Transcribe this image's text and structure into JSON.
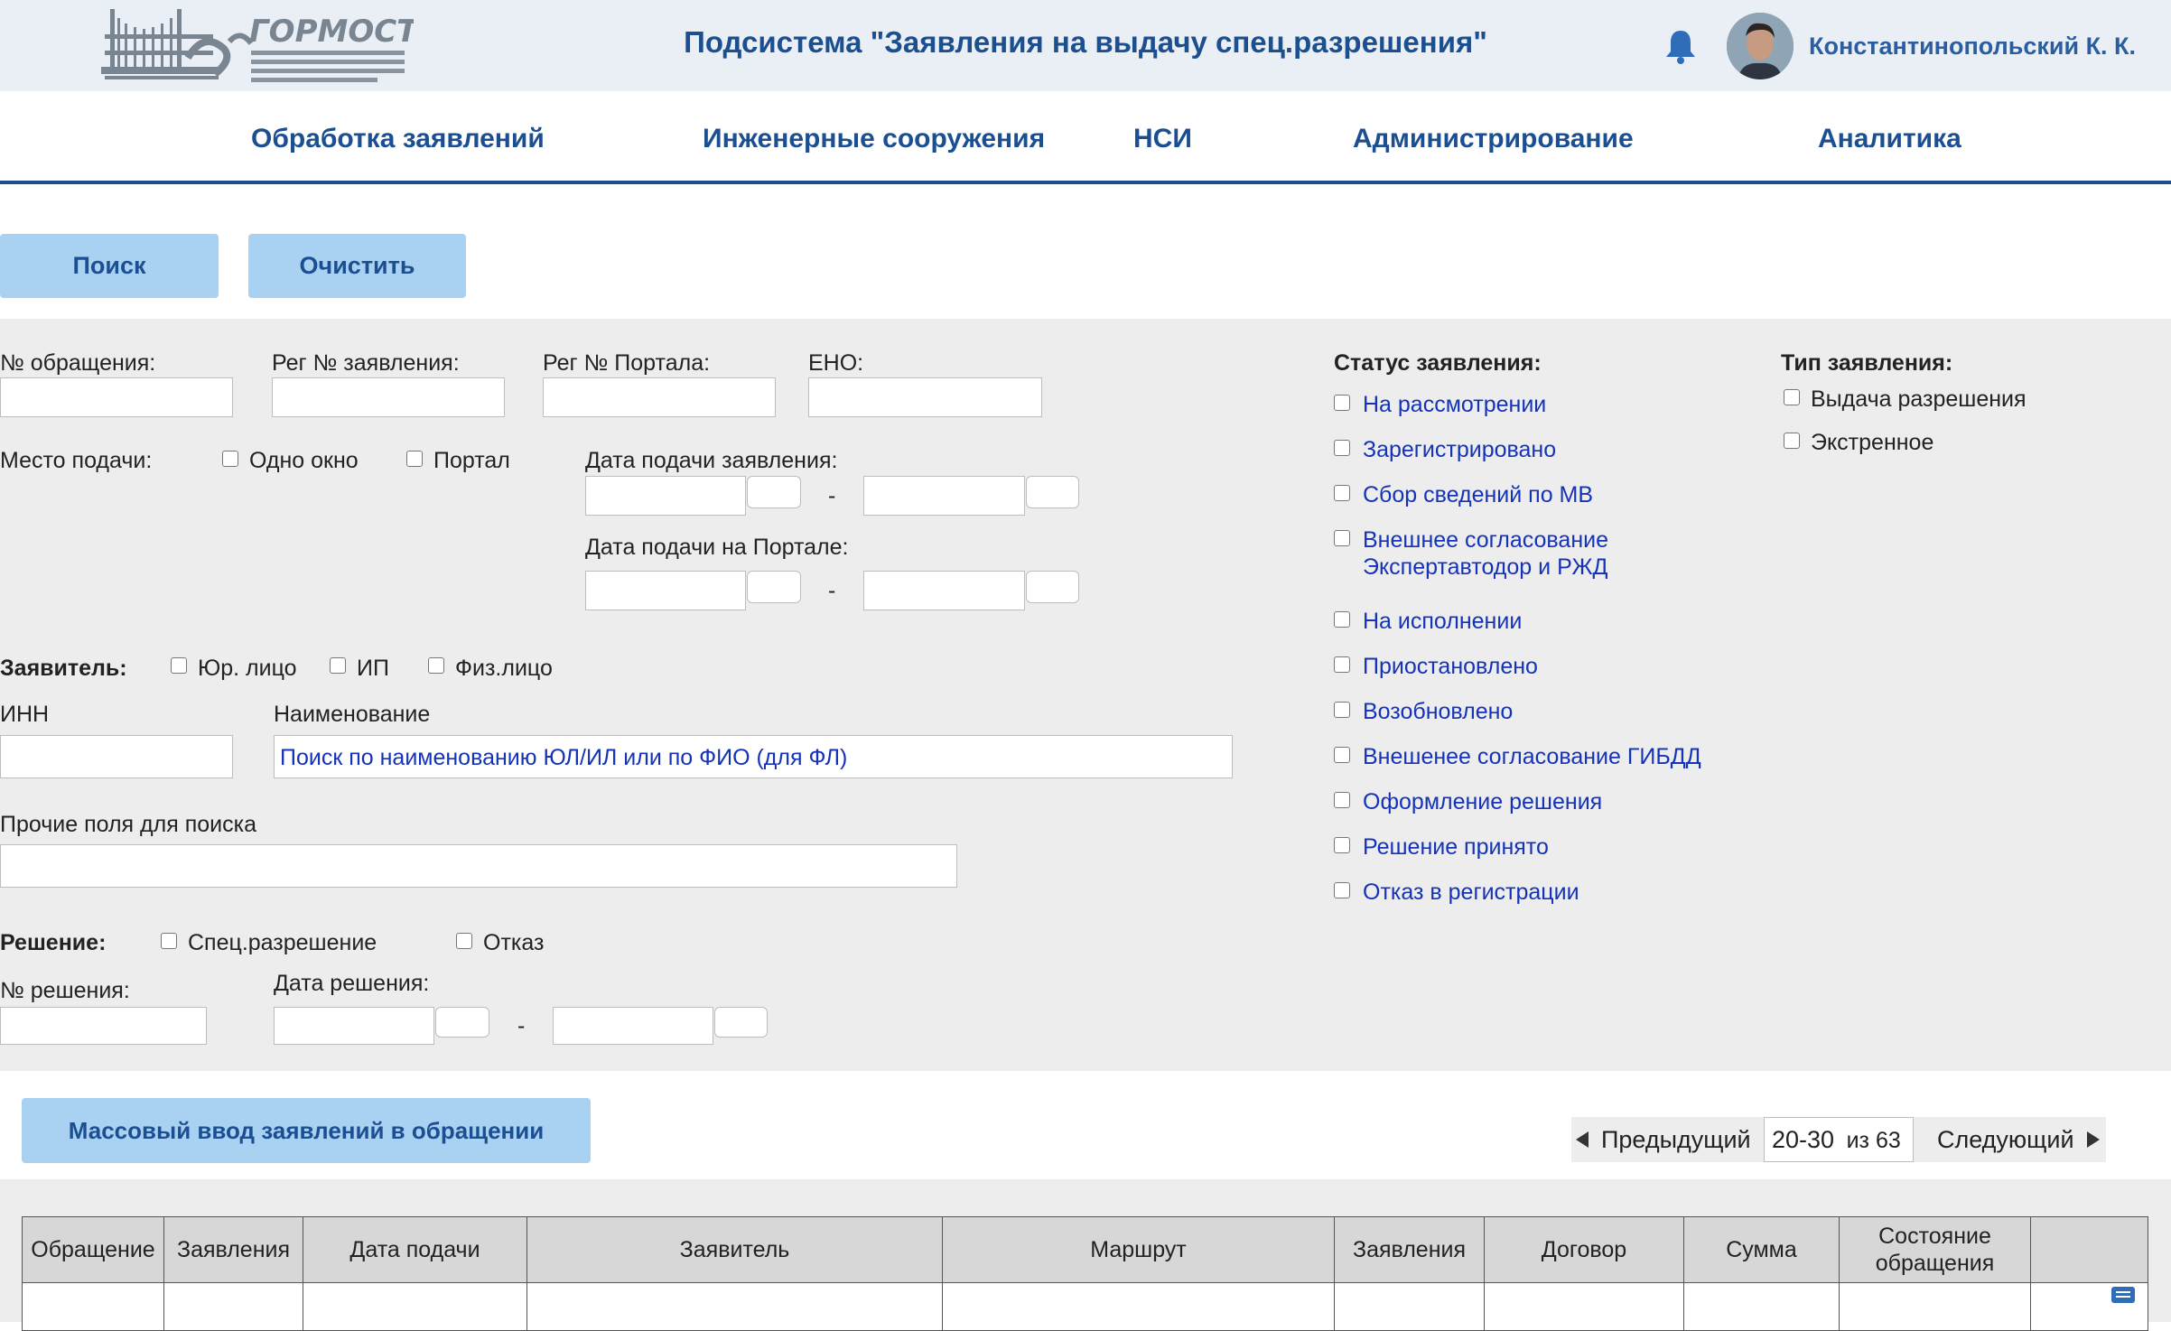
{
  "header": {
    "logo_text": "ГОРМОСТ",
    "title": "Подсистема \"Заявления на выдачу спец.разрешения\"",
    "bell_icon": "bell-icon",
    "user_name": "Константинопольский К. К."
  },
  "nav": {
    "items": [
      "Обработка заявлений",
      "Инженерные сооружения",
      "НСИ",
      "Администрирование",
      "Аналитика"
    ]
  },
  "actions": {
    "search": "Поиск",
    "clear": "Очистить"
  },
  "filters": {
    "appeal_no": "№ обращения:",
    "reg_no": "Рег № заявления:",
    "portal_reg_no": "Рег № Портала:",
    "eno": "ЕНО:",
    "place_label": "Место подачи:",
    "place_one_window": "Одно окно",
    "place_portal": "Портал",
    "date_submit": "Дата подачи заявления:",
    "date_portal": "Дата подачи на Портале:",
    "dash": "-",
    "applicant_label": "Заявитель:",
    "applicant_legal": "Юр. лицо",
    "applicant_ip": "ИП",
    "applicant_person": "Физ.лицо",
    "inn": "ИНН",
    "name_label": "Наименование",
    "name_value": "Поиск по наименованию ЮЛ/ИЛ или по ФИО (для ФЛ)",
    "other_fields": "Прочие поля для поиска",
    "decision_label": "Решение:",
    "decision_special": "Спец.разрешение",
    "decision_refusal": "Отказ",
    "decision_no": "№ решения:",
    "decision_date": "Дата решения:"
  },
  "status": {
    "title": "Статус заявления:",
    "items": [
      "На рассмотрении",
      "Зарегистрировано",
      "Сбор сведений по МВ",
      "Внешнее согласование",
      "Экспертавтодор и РЖД",
      "На исполнении",
      "Приостановлено",
      "Возобновлено",
      "Внешенее согласование ГИБДД",
      "Оформление решения",
      "Решение принято",
      "Отказ в регистрации"
    ]
  },
  "type": {
    "title": "Тип заявления:",
    "items": [
      "Выдача разрешения",
      "Экстренное"
    ]
  },
  "mass_input": "Массовый ввод заявлений в обращении",
  "pager": {
    "prev": "Предыдущий",
    "range": "20-30",
    "of": "из 63",
    "next": "Следующий"
  },
  "table": {
    "columns": [
      "Обращение",
      "Заявления",
      "Дата подачи",
      "Заявитель",
      "Маршрут",
      "Заявления",
      "Договор",
      "Сумма",
      "Состояние обращения",
      ""
    ]
  }
}
